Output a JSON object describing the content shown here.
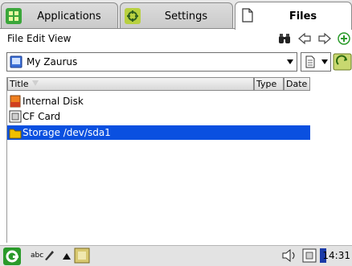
{
  "tabs": [
    {
      "label": "Applications",
      "icon": "applications-icon"
    },
    {
      "label": "Settings",
      "icon": "settings-icon"
    },
    {
      "label": "Files",
      "icon": "document-icon",
      "active": true
    }
  ],
  "menu": {
    "file": "File",
    "edit": "Edit",
    "view": "View"
  },
  "toolbar_icons": [
    "binoculars-icon",
    "back-arrow-icon",
    "forward-arrow-icon",
    "add-icon"
  ],
  "location": {
    "value": "My Zaurus",
    "icon": "zaurus-icon"
  },
  "columns": {
    "title": "Title",
    "type": "Type",
    "date": "Date"
  },
  "files": [
    {
      "name": "Internal Disk",
      "icon": "internal-disk-icon"
    },
    {
      "name": "CF Card",
      "icon": "cf-card-icon"
    },
    {
      "name": "Storage /dev/sda1",
      "icon": "folder-icon",
      "selected": true
    }
  ],
  "taskbar": {
    "clock": "14:31",
    "input_method": "abc"
  },
  "colors": {
    "selection": "#0a50e0",
    "tab_bg": "#d0d0d0",
    "accent_green": "#2a9a2a"
  }
}
